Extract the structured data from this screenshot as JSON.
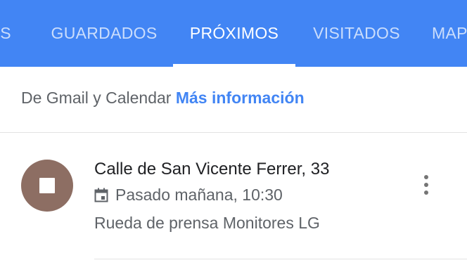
{
  "tabs": [
    {
      "label": "OS"
    },
    {
      "label": "GUARDADOS"
    },
    {
      "label": "PRÓXIMOS"
    },
    {
      "label": "VISITADOS"
    },
    {
      "label": "MAP"
    }
  ],
  "active_tab": "PRÓXIMOS",
  "info": {
    "text": "De Gmail y Calendar ",
    "link": "Más información"
  },
  "event": {
    "title": "Calle de San Vicente Ferrer, 33",
    "date": "Pasado mañana, 10:30",
    "subtitle": "Rueda de prensa Monitores LG",
    "icon": "calendar-icon",
    "avatar_icon": "stop-square-icon"
  },
  "colors": {
    "tabbar": "#4285f4",
    "link": "#4285f4",
    "avatar": "#8d6e63"
  }
}
